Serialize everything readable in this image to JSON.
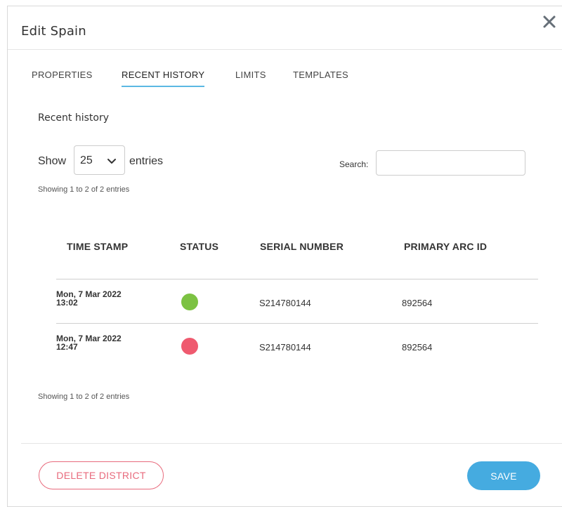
{
  "dialog": {
    "title": "Edit Spain",
    "close_icon": "close-icon"
  },
  "tabs": [
    {
      "label": "PROPERTIES",
      "active": false
    },
    {
      "label": "RECENT HISTORY",
      "active": true
    },
    {
      "label": "LIMITS",
      "active": false
    },
    {
      "label": "TEMPLATES",
      "active": false
    }
  ],
  "history": {
    "section_title": "Recent history",
    "show_label": "Show",
    "page_length": "25",
    "entries_label": "entries",
    "search_label": "Search:",
    "search_value": "",
    "info_top": "Showing 1 to 2 of 2 entries",
    "info_bottom": "Showing 1 to 2 of 2 entries",
    "columns": [
      "TIME STAMP",
      "STATUS",
      "SERIAL NUMBER",
      "PRIMARY ARC ID"
    ],
    "rows": [
      {
        "timestamp_date": "Mon, 7 Mar 2022",
        "timestamp_time": "13:02",
        "status": "ok",
        "status_color": "#7cc242",
        "serial": "S214780144",
        "arc_id": "892564"
      },
      {
        "timestamp_date": "Mon, 7 Mar 2022",
        "timestamp_time": "12:47",
        "status": "error",
        "status_color": "#ef5a6f",
        "serial": "S214780144",
        "arc_id": "892564"
      }
    ]
  },
  "footer": {
    "delete_label": "DELETE DISTRICT",
    "save_label": "SAVE"
  },
  "colors": {
    "accent": "#45abe0",
    "tab_underline": "#5bb8e3",
    "danger": "#e86a7c"
  }
}
